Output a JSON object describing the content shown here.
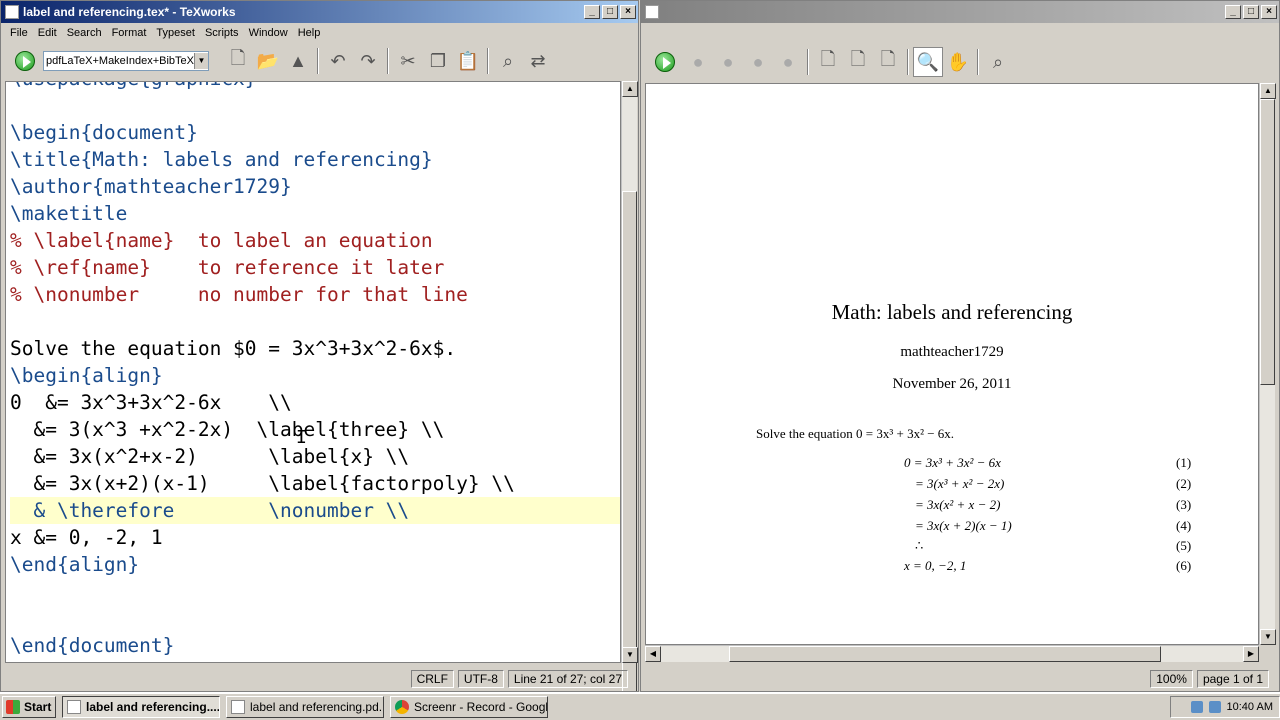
{
  "editor": {
    "title": "label and referencing.tex* - TeXworks",
    "menu": [
      "File",
      "Edit",
      "Search",
      "Format",
      "Typeset",
      "Scripts",
      "Window",
      "Help"
    ],
    "typeset_engine": "pdfLaTeX+MakeIndex+BibTeX",
    "lines": [
      {
        "text": "\\usepackage{graphicx}",
        "style": "kw",
        "current": false
      },
      {
        "text": "",
        "style": "plain",
        "current": false
      },
      {
        "text": "\\begin{document}",
        "style": "kw",
        "current": false
      },
      {
        "text": "\\title{Math: labels and referencing}",
        "style": "kw",
        "current": false
      },
      {
        "text": "\\author{mathteacher1729}",
        "style": "kw",
        "current": false
      },
      {
        "text": "\\maketitle",
        "style": "kw",
        "current": false
      },
      {
        "text": "% \\label{name}  to label an equation",
        "style": "cmt",
        "current": false
      },
      {
        "text": "% \\ref{name}    to reference it later",
        "style": "cmt",
        "current": false
      },
      {
        "text": "% \\nonumber     no number for that line",
        "style": "cmt",
        "current": false
      },
      {
        "text": "",
        "style": "plain",
        "current": false
      },
      {
        "text": "Solve the equation $0 = 3x^3+3x^2-6x$.",
        "style": "plain",
        "current": false
      },
      {
        "text": "\\begin{align}",
        "style": "kw",
        "current": false
      },
      {
        "text": "0  &= 3x^3+3x^2-6x    \\\\",
        "style": "plain",
        "current": false
      },
      {
        "text": "  &= 3(x^3 +x^2-2x)  \\label{three} \\\\",
        "style": "plain",
        "current": false
      },
      {
        "text": "  &= 3x(x^2+x-2)      \\label{x} \\\\",
        "style": "plain",
        "current": false
      },
      {
        "text": "  &= 3x(x+2)(x-1)     \\label{factorpoly} \\\\",
        "style": "plain",
        "current": false
      },
      {
        "text": "  & \\therefore        \\nonumber \\\\",
        "style": "kw",
        "current": true
      },
      {
        "text": "x &= 0, -2, 1",
        "style": "plain",
        "current": false
      },
      {
        "text": "\\end{align}",
        "style": "kw",
        "current": false
      },
      {
        "text": "",
        "style": "plain",
        "current": false
      },
      {
        "text": "",
        "style": "plain",
        "current": false
      },
      {
        "text": "\\end{document}",
        "style": "kw",
        "current": false
      }
    ],
    "status": {
      "line_ending": "CRLF",
      "encoding": "UTF-8",
      "position": "Line 21 of 27; col 27"
    }
  },
  "preview": {
    "doc_title": "Math: labels and referencing",
    "doc_author": "mathteacher1729",
    "doc_date": "November 26, 2011",
    "solve_text": "Solve the equation 0 = 3x³ + 3x² − 6x.",
    "equations": [
      {
        "lhs": "0 = 3x³ + 3x² − 6x",
        "num": "(1)"
      },
      {
        "lhs": "= 3(x³ + x² − 2x)",
        "num": "(2)"
      },
      {
        "lhs": "= 3x(x² + x − 2)",
        "num": "(3)"
      },
      {
        "lhs": "= 3x(x + 2)(x − 1)",
        "num": "(4)"
      },
      {
        "lhs": "∴",
        "num": "(5)"
      },
      {
        "lhs": "x = 0, −2, 1",
        "num": "(6)"
      }
    ],
    "status": {
      "zoom": "100%",
      "page": "page 1 of 1"
    }
  },
  "taskbar": {
    "start_label": "Start",
    "tasks": [
      "label and referencing....",
      "label and referencing.pd...",
      "Screenr - Record - Googl..."
    ],
    "clock": "10:40 AM"
  }
}
